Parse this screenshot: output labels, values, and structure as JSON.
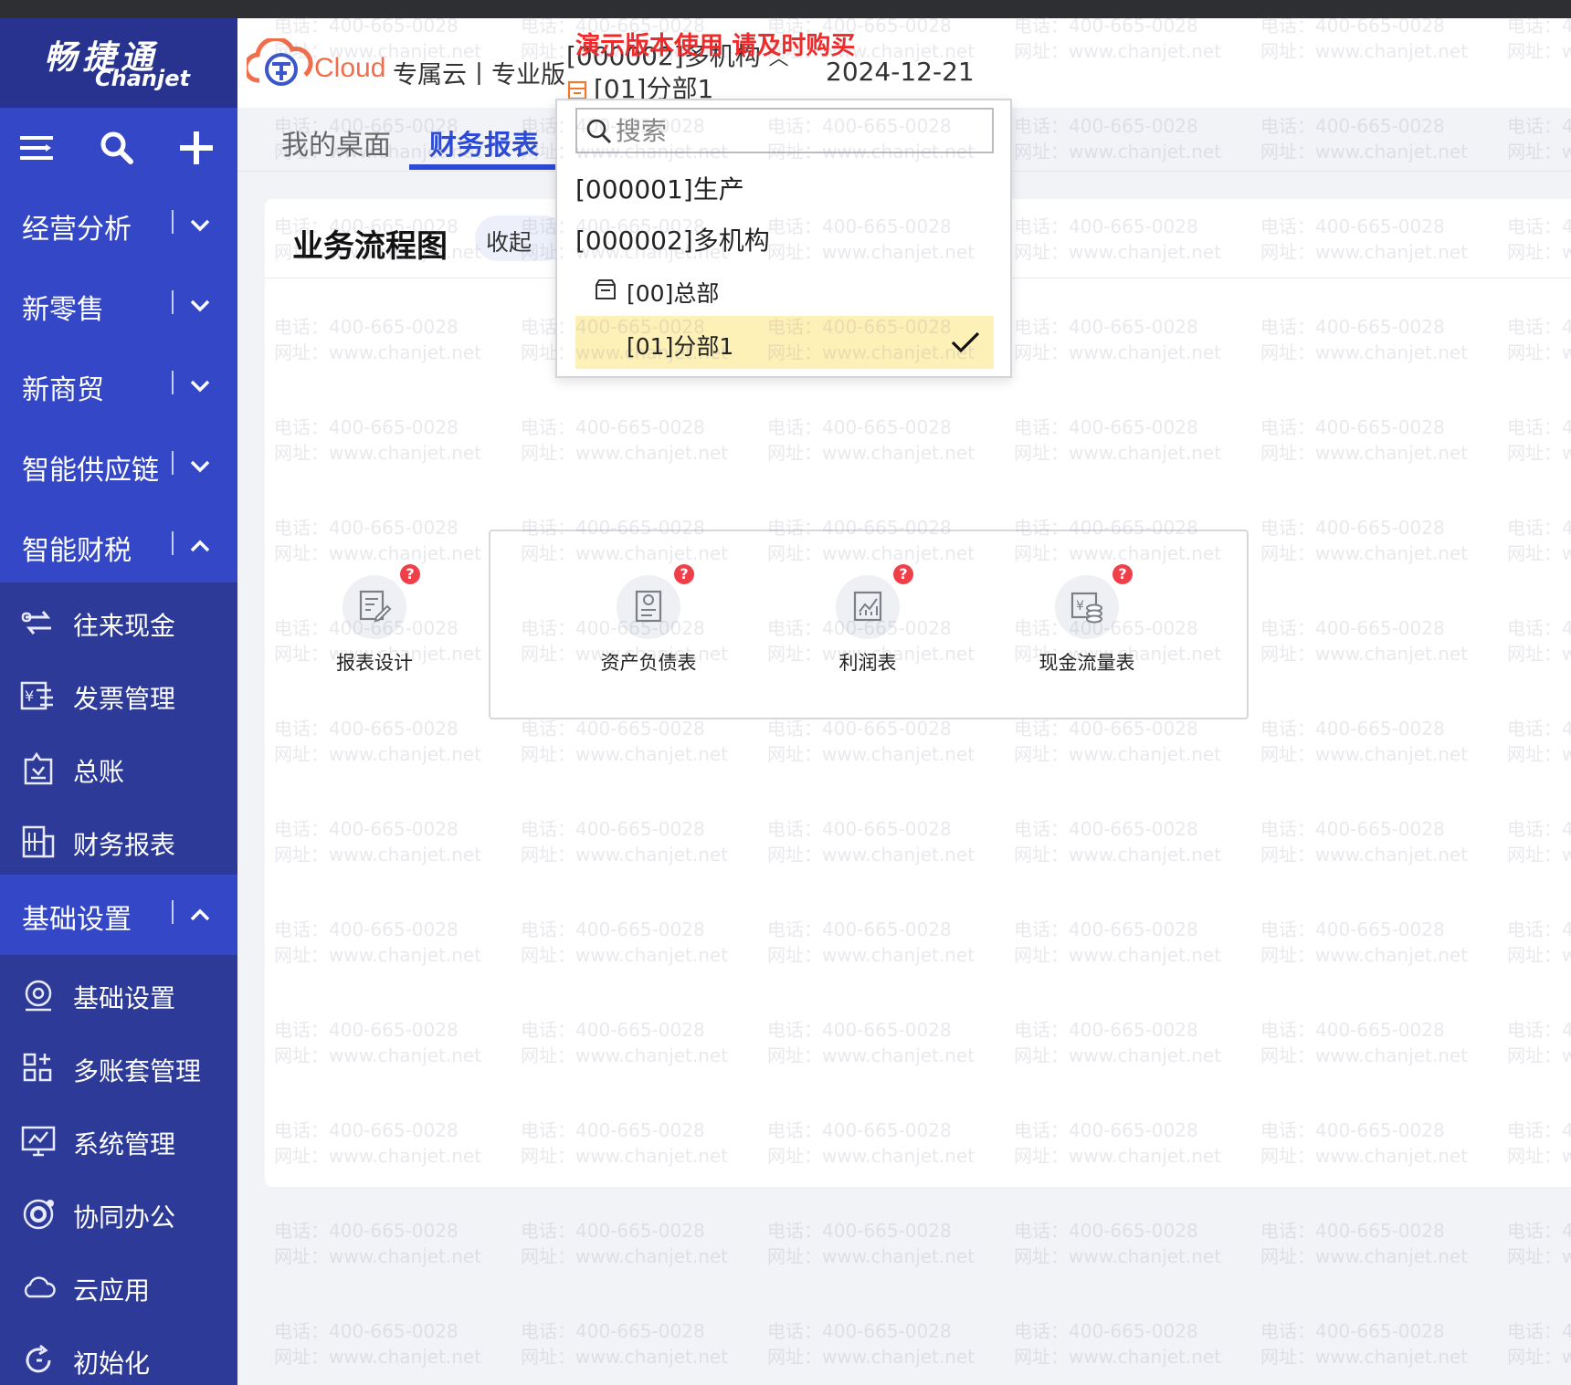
{
  "logo": {
    "cn": "畅捷通",
    "en": "Chanjet"
  },
  "header": {
    "brand": "Cloud",
    "edition": "专属云丨专业版",
    "promo": "演示版本使用  请及时购买",
    "org_line1": "[000002]多机构",
    "org_line2": "[01]分部1",
    "date": "2024-12-21"
  },
  "sidebar": {
    "groups": [
      {
        "label": "经营分析",
        "expanded": false
      },
      {
        "label": "新零售",
        "expanded": false
      },
      {
        "label": "新商贸",
        "expanded": false
      },
      {
        "label": "智能供应链",
        "expanded": false
      },
      {
        "label": "智能财税",
        "expanded": true
      },
      {
        "label": "基础设置",
        "expanded": true
      }
    ],
    "finance_items": [
      {
        "label": "往来现金",
        "icon": "transfer-icon"
      },
      {
        "label": "发票管理",
        "icon": "invoice-icon"
      },
      {
        "label": "总账",
        "icon": "ledger-icon"
      },
      {
        "label": "财务报表",
        "icon": "report-building-icon"
      }
    ],
    "basic_items": [
      {
        "label": "基础设置",
        "icon": "settings-icon"
      },
      {
        "label": "多账套管理",
        "icon": "grid-icon"
      },
      {
        "label": "系统管理",
        "icon": "monitor-icon"
      },
      {
        "label": "协同办公",
        "icon": "collab-icon"
      },
      {
        "label": "云应用",
        "icon": "cloud-icon"
      },
      {
        "label": "初始化",
        "icon": "refresh-icon"
      }
    ]
  },
  "tabs": [
    {
      "label": "我的桌面",
      "active": false
    },
    {
      "label": "财务报表",
      "active": true
    }
  ],
  "card": {
    "title": "业务流程图",
    "collapse_label": "收起",
    "functions": [
      {
        "label": "报表设计",
        "icon": "report-design-icon"
      },
      {
        "label": "资产负债表",
        "icon": "balance-sheet-icon"
      },
      {
        "label": "利润表",
        "icon": "profit-chart-icon"
      },
      {
        "label": "现金流量表",
        "icon": "cashflow-icon"
      }
    ]
  },
  "dropdown": {
    "search_placeholder": "搜索",
    "items": [
      {
        "label": "[000001]生产"
      },
      {
        "label": "[000002]多机构"
      }
    ],
    "sub_items": [
      {
        "label": "[00]总部",
        "selected": false
      },
      {
        "label": "[01]分部1",
        "selected": true
      }
    ]
  },
  "watermark": {
    "phone": "电话：400-665-0028",
    "site": "网址：www.chanjet.net"
  },
  "colors": {
    "sidebar": "#2b3aa8",
    "accent": "#2c4ad6",
    "promo": "#ef2a2a",
    "selected_bg": "#fdf1b8"
  }
}
